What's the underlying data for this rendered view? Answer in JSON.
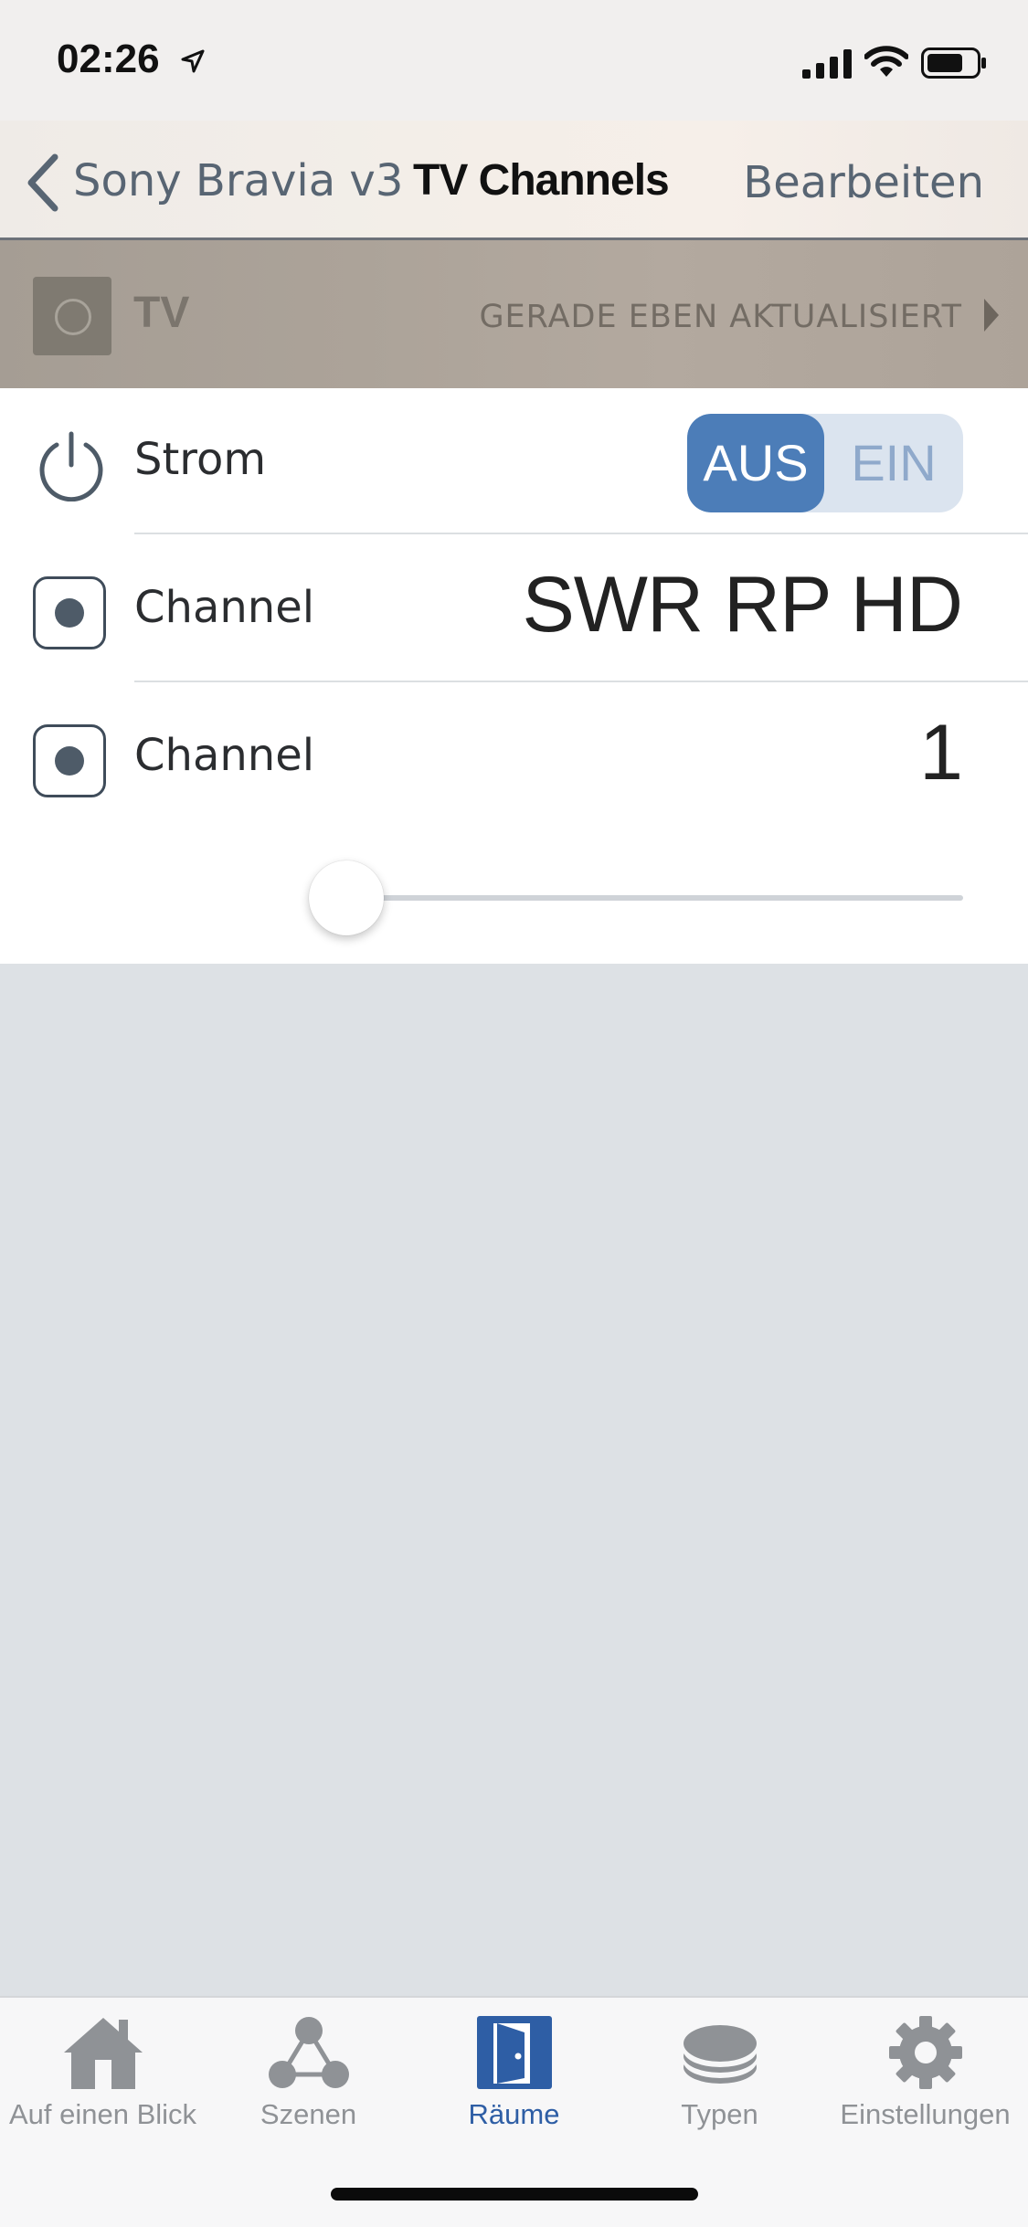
{
  "status_bar": {
    "time": "02:26",
    "icons": [
      "location-arrow-icon",
      "cellular-signal-icon",
      "wifi-icon",
      "battery-icon"
    ]
  },
  "nav": {
    "back_label": "Sony Bravia v3",
    "title": "TV Channels",
    "edit_label": "Bearbeiten"
  },
  "room": {
    "name": "TV",
    "status": "GERADE EBEN AKTUALISIERT"
  },
  "rows": {
    "power": {
      "label": "Strom",
      "off_label": "AUS",
      "on_label": "EIN",
      "selected": "AUS"
    },
    "channel_name": {
      "label": "Channel",
      "value": "SWR RP HD"
    },
    "channel_number": {
      "label": "Channel",
      "value": "1",
      "slider_fraction": 0.0
    }
  },
  "tabs": [
    {
      "label": "Auf einen Blick",
      "icon": "house-icon",
      "active": false
    },
    {
      "label": "Szenen",
      "icon": "scenes-icon",
      "active": false
    },
    {
      "label": "Räume",
      "icon": "door-icon",
      "active": true
    },
    {
      "label": "Typen",
      "icon": "layers-icon",
      "active": false
    },
    {
      "label": "Einstellungen",
      "icon": "gear-icon",
      "active": false
    }
  ],
  "colors": {
    "accent": "#4c7db8",
    "active_tab": "#2e5ea5",
    "inactive_tab": "#8f9296",
    "header_bg": "#aca399"
  }
}
